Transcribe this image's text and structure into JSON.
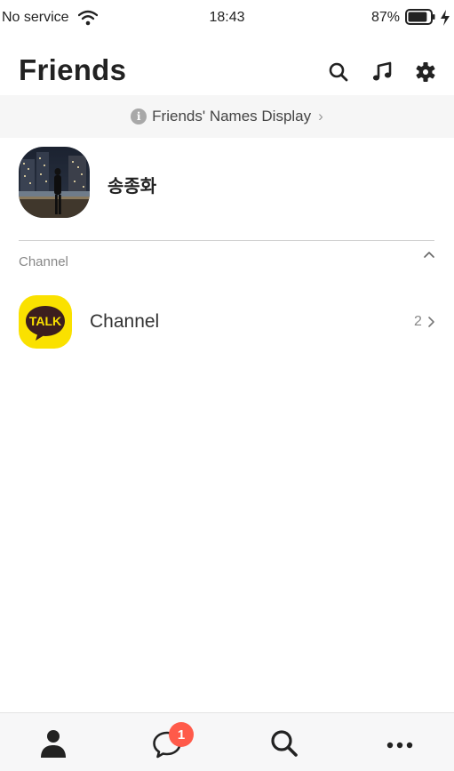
{
  "status_bar": {
    "carrier": "No service",
    "time": "18:43",
    "battery_percent": "87%",
    "battery_level": 0.87,
    "charging": true
  },
  "header": {
    "title": "Friends",
    "icons": [
      "search-icon",
      "music-icon",
      "settings-icon"
    ]
  },
  "banner": {
    "label": "Friends' Names Display",
    "chevron": "›"
  },
  "profile": {
    "name": "송종화"
  },
  "channel_section": {
    "label": "Channel",
    "item": {
      "logo_text": "TALK",
      "name": "Channel",
      "count": "2",
      "logo_color": "#fae100"
    }
  },
  "tab_bar": {
    "tabs": [
      "friends-tab",
      "chats-tab",
      "search-tab",
      "more-tab"
    ],
    "chats_badge": "1",
    "badge_color": "#ff5a4a"
  }
}
